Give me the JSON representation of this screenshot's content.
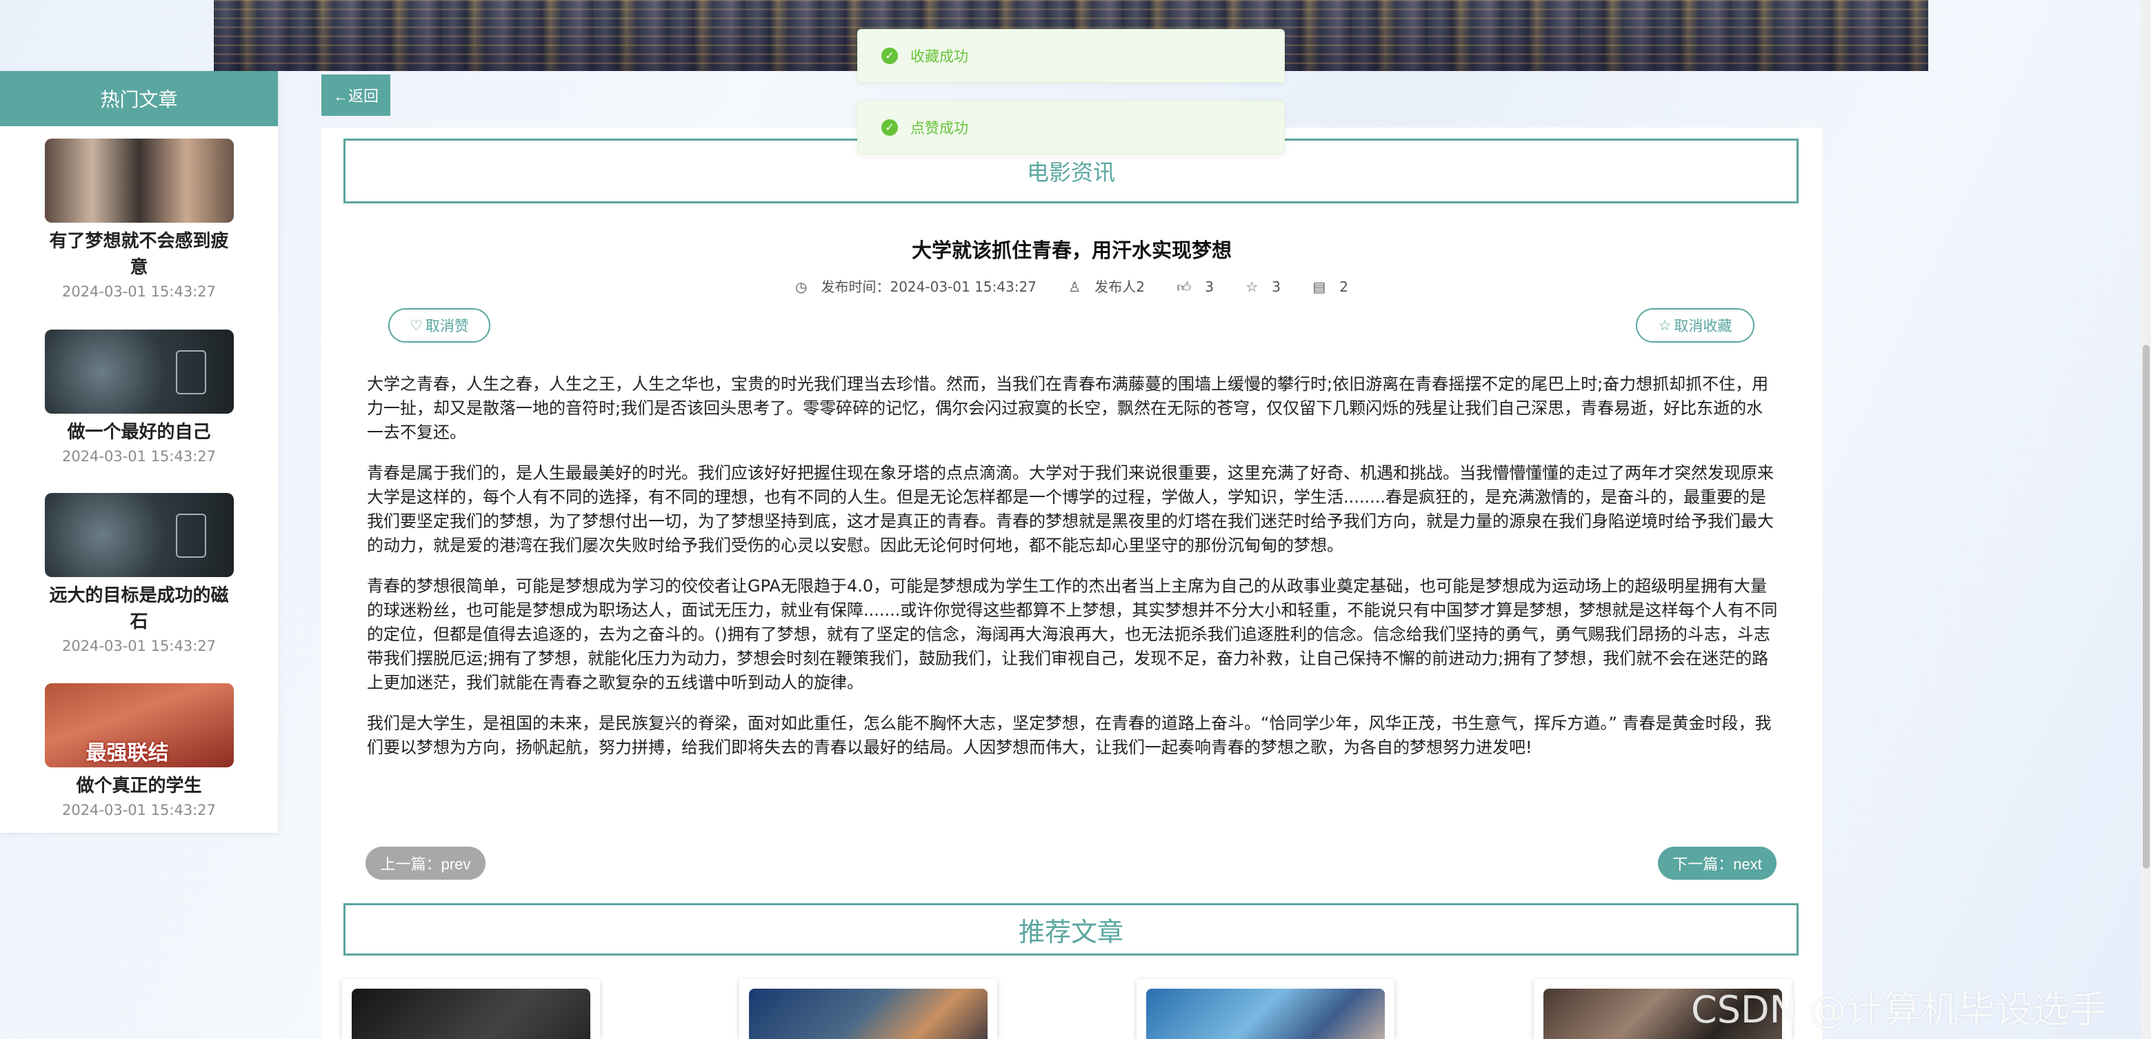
{
  "sidebar": {
    "header": "热门文章",
    "items": [
      {
        "title": "有了梦想就不会感到疲意",
        "date": "2024-03-01 15:43:27"
      },
      {
        "title": "做一个最好的自己",
        "date": "2024-03-01 15:43:27"
      },
      {
        "title": "远大的目标是成功的磁石",
        "date": "2024-03-01 15:43:27"
      },
      {
        "title": "做个真正的学生",
        "date": "2024-03-01 15:43:27"
      }
    ]
  },
  "back_label": "←返回",
  "toasts": [
    "收藏成功",
    "点赞成功"
  ],
  "category": "电影资讯",
  "article": {
    "title": "大学就该抓住青春，用汗水实现梦想",
    "meta": {
      "publish_time": "发布时间：2024-03-01 15:43:27",
      "publisher": "发布人2",
      "likes": "3",
      "favorites": "3",
      "comments": "2"
    },
    "unlike_label": "取消赞",
    "uncollect_label": "取消收藏",
    "paragraphs": [
      "大学之青春，人生之春，人生之王，人生之华也，宝贵的时光我们理当去珍惜。然而，当我们在青春布满藤蔓的围墙上缓慢的攀行时;依旧游离在青春摇摆不定的尾巴上时;奋力想抓却抓不住，用力一扯，却又是散落一地的音符时;我们是否该回头思考了。零零碎碎的记忆，偶尔会闪过寂寞的长空，飘然在无际的苍穹，仅仅留下几颗闪烁的残星让我们自己深思，青春易逝，好比东逝的水一去不复还。",
      "青春是属于我们的，是人生最最美好的时光。我们应该好好把握住现在象牙塔的点点滴滴。大学对于我们来说很重要，这里充满了好奇、机遇和挑战。当我懵懵懂懂的走过了两年才突然发现原来大学是这样的，每个人有不同的选择，有不同的理想，也有不同的人生。但是无论怎样都是一个博学的过程，学做人，学知识，学生活........春是疯狂的，是充满激情的，是奋斗的，最重要的是我们要坚定我们的梦想，为了梦想付出一切，为了梦想坚持到底，这才是真正的青春。青春的梦想就是黑夜里的灯塔在我们迷茫时给予我们方向，就是力量的源泉在我们身陷逆境时给予我们最大的动力，就是爱的港湾在我们屡次失败时给予我们受伤的心灵以安慰。因此无论何时何地，都不能忘却心里坚守的那份沉甸甸的梦想。",
      "青春的梦想很简单，可能是梦想成为学习的佼佼者让GPA无限趋于4.0，可能是梦想成为学生工作的杰出者当上主席为自己的从政事业奠定基础，也可能是梦想成为运动场上的超级明星拥有大量的球迷粉丝，也可能是梦想成为职场达人，面试无压力，就业有保障.......或许你觉得这些都算不上梦想，其实梦想并不分大小和轻重，不能说只有中国梦才算是梦想，梦想就是这样每个人有不同的定位，但都是值得去追逐的，去为之奋斗的。()拥有了梦想，就有了坚定的信念，海阔再大海浪再大，也无法扼杀我们追逐胜利的信念。信念给我们坚持的勇气，勇气赐我们昂扬的斗志，斗志带我们摆脱厄运;拥有了梦想，就能化压力为动力，梦想会时刻在鞭策我们，鼓励我们，让我们审视自己，发现不足，奋力补救，让自己保持不懈的前进动力;拥有了梦想，我们就不会在迷茫的路上更加迷茫，我们就能在青春之歌复杂的五线谱中听到动人的旋律。",
      "我们是大学生，是祖国的未来，是民族复兴的脊梁，面对如此重任，怎么能不胸怀大志，坚定梦想，在青春的道路上奋斗。“恰同学少年，风华正茂，书生意气，挥斥方遒。” 青春是黄金时段，我们要以梦想为方向，扬帆起航，努力拼搏，给我们即将失去的青春以最好的结局。人因梦想而伟大，让我们一起奏响青春的梦想之歌，为各自的梦想努力进发吧!"
    ],
    "prev_label": "上一篇：prev",
    "next_label": "下一篇：next"
  },
  "recommend_title": "推荐文章",
  "watermark": "CSDN @计算机毕设选手"
}
